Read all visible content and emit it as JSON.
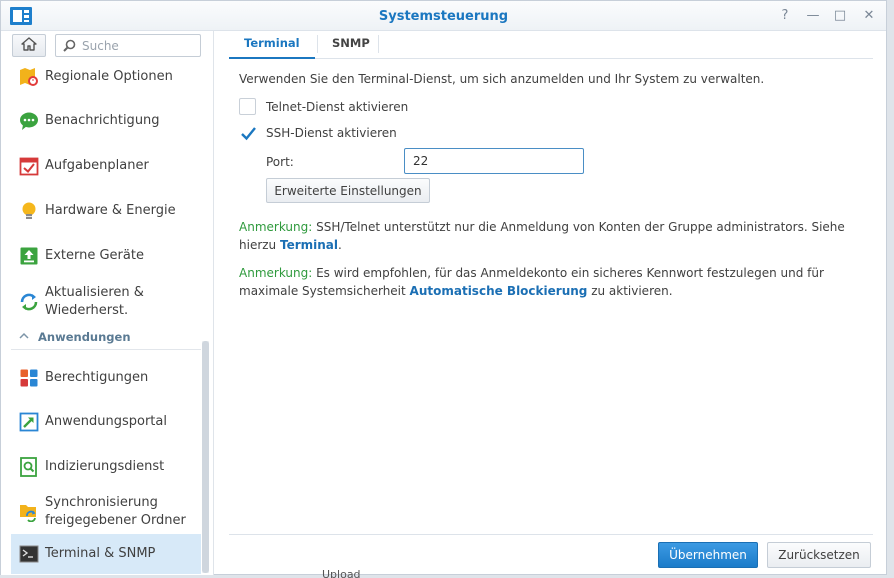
{
  "window": {
    "title": "Systemsteuerung",
    "controls": {
      "help": "?",
      "minimize": "—",
      "maximize": "□",
      "close": "✕"
    }
  },
  "sidebar": {
    "search_placeholder": "Suche",
    "items": [
      {
        "label": "Regionale Optionen",
        "icon": "regional-options-icon"
      },
      {
        "label": "Benachrichtigung",
        "icon": "notification-icon"
      },
      {
        "label": "Aufgabenplaner",
        "icon": "task-scheduler-icon"
      },
      {
        "label": "Hardware & Energie",
        "icon": "hardware-power-icon"
      },
      {
        "label": "Externe Geräte",
        "icon": "external-devices-icon"
      },
      {
        "label": "Aktualisieren & Wiederherst.",
        "icon": "update-restore-icon"
      }
    ],
    "section": {
      "label": "Anwendungen",
      "expanded": true
    },
    "app_items": [
      {
        "label": "Berechtigungen",
        "icon": "privileges-icon"
      },
      {
        "label": "Anwendungsportal",
        "icon": "application-portal-icon"
      },
      {
        "label": "Indizierungsdienst",
        "icon": "indexing-service-icon"
      },
      {
        "label": "Synchronisierung freigegebener Ordner",
        "icon": "shared-folder-sync-icon"
      },
      {
        "label": "Terminal & SNMP",
        "icon": "terminal-icon",
        "active": true
      }
    ]
  },
  "tabs": [
    {
      "label": "Terminal",
      "active": true
    },
    {
      "label": "SNMP",
      "active": false
    }
  ],
  "terminal": {
    "description": "Verwenden Sie den Terminal-Dienst, um sich anzumelden und Ihr System zu verwalten.",
    "telnet": {
      "label": "Telnet-Dienst aktivieren",
      "checked": false
    },
    "ssh": {
      "label": "SSH-Dienst aktivieren",
      "checked": true
    },
    "port_label": "Port:",
    "port_value": "22",
    "advanced_button": "Erweiterte Einstellungen",
    "note1": {
      "label": "Anmerkung:",
      "text": " SSH/Telnet unterstützt nur die Anmeldung von Konten der Gruppe administrators. Siehe hierzu ",
      "link": "Terminal",
      "after": "."
    },
    "note2": {
      "label": "Anmerkung:",
      "text": " Es wird empfohlen, für das Anmeldekonto ein sicheres Kennwort festzulegen und für maximale Systemsicherheit ",
      "link": "Automatische Blockierung",
      "after": " zu aktivieren."
    }
  },
  "footer": {
    "apply": "Übernehmen",
    "reset": "Zurücksetzen"
  },
  "background_peek": "Upload",
  "colors": {
    "accent": "#1b77c0",
    "note_label": "#2f9a3d",
    "active_item": "#d7e9f8"
  }
}
